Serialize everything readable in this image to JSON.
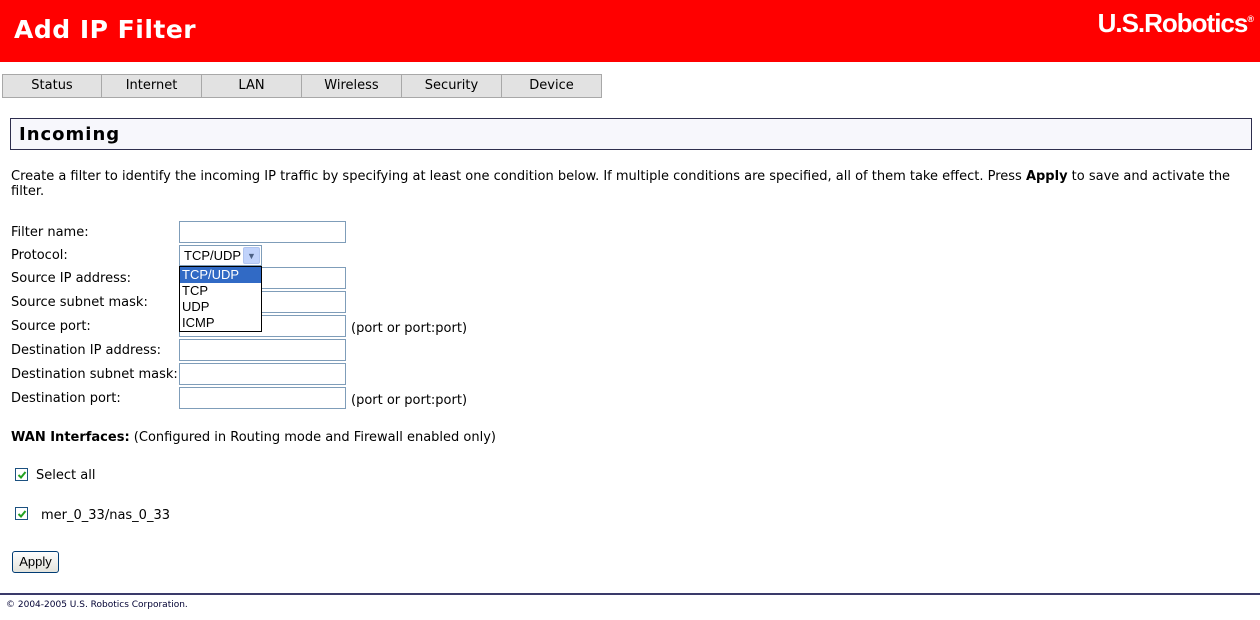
{
  "header": {
    "title": "Add IP Filter",
    "brand": "U.S.Robotics",
    "brand_mark": "®"
  },
  "nav": {
    "tabs": [
      "Status",
      "Internet",
      "LAN",
      "Wireless",
      "Security",
      "Device"
    ]
  },
  "section": {
    "title": "Incoming"
  },
  "description": {
    "before": "Create a filter to identify the incoming IP traffic by specifying at least one condition below. If multiple conditions are specified, all of them take effect. Press ",
    "bold": "Apply",
    "after": " to save and activate the filter."
  },
  "form": {
    "filter_name": {
      "label": "Filter name:",
      "value": ""
    },
    "protocol": {
      "label": "Protocol:",
      "selected": "TCP/UDP",
      "options": [
        "TCP/UDP",
        "TCP",
        "UDP",
        "ICMP"
      ]
    },
    "source_ip": {
      "label": "Source IP address:",
      "value": ""
    },
    "source_mask": {
      "label": "Source subnet mask:",
      "value": ""
    },
    "source_port": {
      "label": "Source port:",
      "value": "",
      "hint": "(port or port:port)"
    },
    "dest_ip": {
      "label": "Destination IP address:",
      "value": ""
    },
    "dest_mask": {
      "label": "Destination subnet mask:",
      "value": ""
    },
    "dest_port": {
      "label": "Destination port:",
      "value": "",
      "hint": "(port or port:port)"
    }
  },
  "wan": {
    "label": "WAN Interfaces:",
    "note": "(Configured in Routing mode and Firewall enabled only)",
    "select_all": "Select all",
    "interface": "mer_0_33/nas_0_33"
  },
  "buttons": {
    "apply": "Apply"
  },
  "footer": {
    "copyright": "© 2004-2005 U.S. Robotics Corporation."
  },
  "colors": {
    "header_bg": "#ff0000",
    "tab_bg": "#e2e2e2",
    "selection": "#316ac5"
  }
}
